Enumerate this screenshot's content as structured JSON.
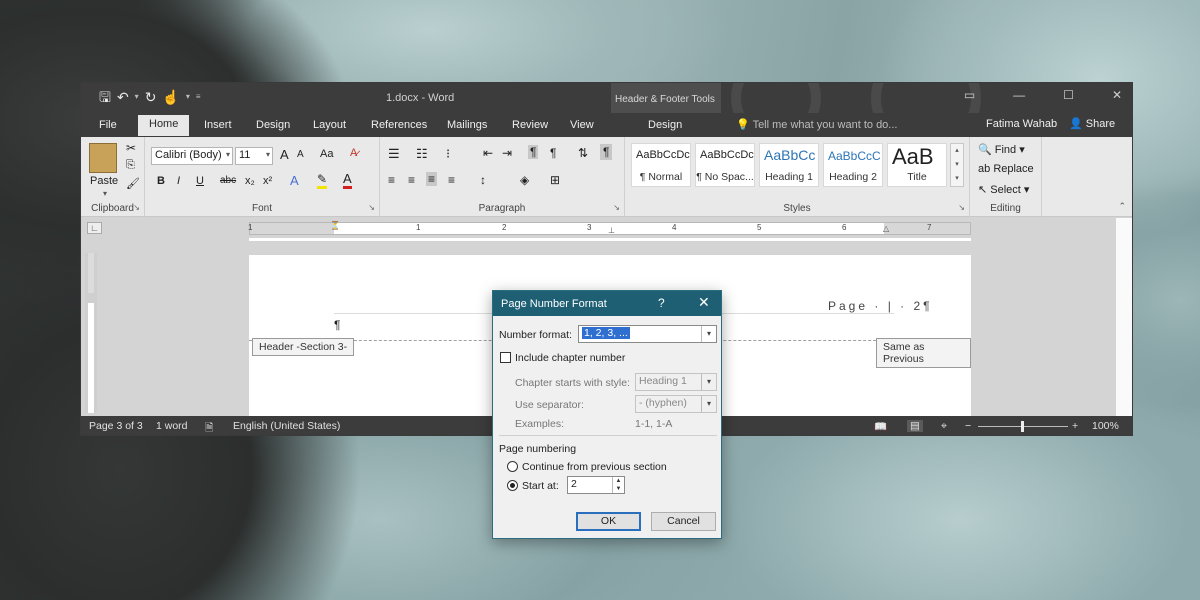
{
  "window": {
    "doc_title": "1.docx - Word",
    "context_label": "Header & Footer Tools",
    "qat_icons": [
      "save-icon",
      "undo-icon",
      "redo-icon",
      "touch-mode-icon",
      "customize-icon"
    ]
  },
  "tabs": [
    "File",
    "Home",
    "Insert",
    "Design",
    "Layout",
    "References",
    "Mailings",
    "Review",
    "View",
    "Design"
  ],
  "active_tab": "Home",
  "tell_me": "Tell me what you want to do...",
  "user": "Fatima Wahab",
  "share": "Share",
  "ribbon": {
    "clipboard": {
      "paste": "Paste",
      "label": "Clipboard"
    },
    "font": {
      "name": "Calibri (Body)",
      "size": "11",
      "label": "Font",
      "bold": "B",
      "italic": "I",
      "underline": "U",
      "strike": "abc",
      "sub": "x₂",
      "sup": "x²",
      "grow": "A",
      "shrink": "A",
      "case": "Aa"
    },
    "paragraph": {
      "label": "Paragraph"
    },
    "styles": {
      "label": "Styles",
      "items": [
        {
          "sample": "AaBbCcDc",
          "name": "¶ Normal"
        },
        {
          "sample": "AaBbCcDc",
          "name": "¶ No Spac..."
        },
        {
          "sample": "AaBbCc",
          "name": "Heading 1"
        },
        {
          "sample": "AaBbCcC",
          "name": "Heading 2"
        },
        {
          "sample": "AaB",
          "name": "Title"
        }
      ]
    },
    "editing": {
      "label": "Editing",
      "find": "Find",
      "replace": "Replace",
      "select": "Select"
    }
  },
  "ruler_numbers": [
    "1",
    "1",
    "2",
    "3",
    "4",
    "5",
    "6",
    "7"
  ],
  "document": {
    "header_text": "Page · | · 2¶",
    "pilcrow": "¶",
    "header_tag": "Header -Section 3-",
    "same_as_previous": "Same as Previous"
  },
  "statusbar": {
    "page": "Page 3 of 3",
    "words": "1 word",
    "language": "English (United States)",
    "zoom": "100%"
  },
  "dialog": {
    "title": "Page Number Format",
    "help": "?",
    "number_format_label": "Number format:",
    "number_format_value": "1, 2, 3, ...",
    "include_chapter": "Include chapter number",
    "chapter_starts_label": "Chapter starts with style:",
    "chapter_starts_value": "Heading 1",
    "separator_label": "Use separator:",
    "separator_value": "-   (hyphen)",
    "examples_label": "Examples:",
    "examples_value": "1-1, 1-A",
    "page_numbering_label": "Page numbering",
    "continue_label": "Continue from previous section",
    "start_at_label": "Start at:",
    "start_at_value": "2",
    "ok": "OK",
    "cancel": "Cancel"
  }
}
